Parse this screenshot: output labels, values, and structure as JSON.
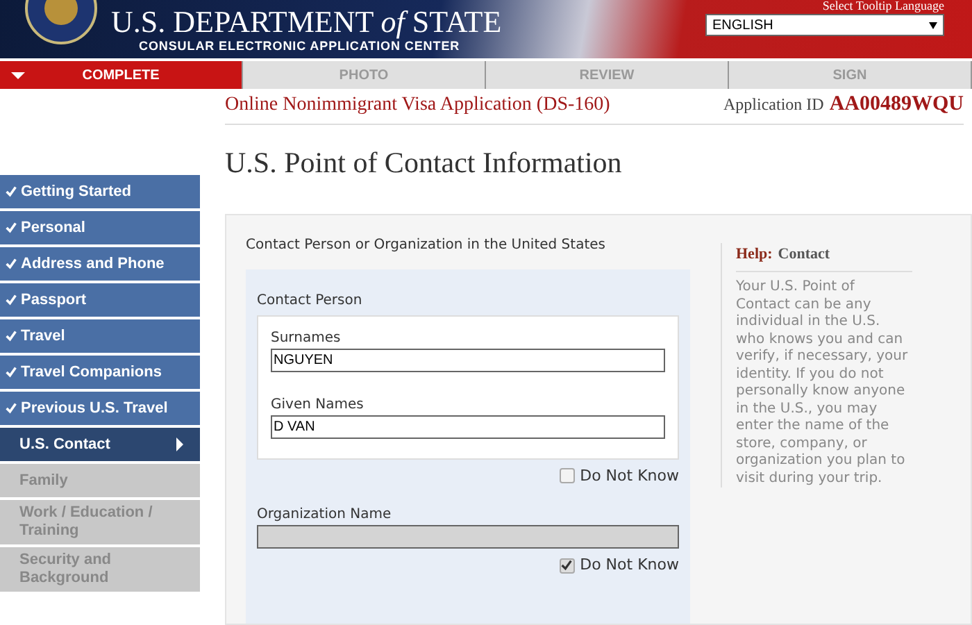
{
  "header": {
    "title": "U.S. DEPARTMENT *of* STATE",
    "subtitle": "CONSULAR ELECTRONIC APPLICATION CENTER",
    "language_label": "Select Tooltip Language",
    "language": "ENGLISH"
  },
  "steps": [
    {
      "label": "COMPLETE",
      "selected": true
    },
    {
      "label": "PHOTO",
      "selected": false
    },
    {
      "label": "REVIEW",
      "selected": false
    },
    {
      "label": "SIGN",
      "selected": false
    }
  ],
  "form_title": "Online Nonimmigrant Visa Application (DS-160)",
  "application_id_label": "Application ID",
  "application_id": "AA00489WQU",
  "sidebar": {
    "items": [
      {
        "label": "Getting Started",
        "kind": "done"
      },
      {
        "label": "Personal",
        "kind": "done"
      },
      {
        "label": "Address and Phone",
        "kind": "done"
      },
      {
        "label": "Passport",
        "kind": "done"
      },
      {
        "label": "Travel",
        "kind": "done"
      },
      {
        "label": "Travel Companions",
        "kind": "done"
      },
      {
        "label": "Previous U.S. Travel",
        "kind": "done"
      },
      {
        "label": "U.S. Contact",
        "kind": "current"
      },
      {
        "label": "Family",
        "kind": "locked"
      },
      {
        "label": "Work / Education / Training",
        "kind": "locked"
      },
      {
        "label": "Security and Background",
        "kind": "locked"
      }
    ]
  },
  "page_title": "U.S. Point of Contact Information",
  "section_title": "Contact Person or Organization in the United States",
  "contact_person": {
    "legend": "Contact Person",
    "fields": [
      {
        "label": "Surnames",
        "value": "NGUYEN"
      },
      {
        "label": "Given Names",
        "value": "D VAN"
      }
    ],
    "do_not_know": {
      "label": "Do Not Know",
      "checked": false
    }
  },
  "organization": {
    "label": "Organization Name",
    "disabled": true,
    "do_not_know": {
      "label": "Do Not Know",
      "checked": true
    }
  },
  "help": {
    "label": "Help:",
    "topic": "Contact",
    "text": "Your U.S. Point of Contact can be any individual in the U.S. who knows you and can verify, if necessary, your identity. If you do not personally know anyone in the U.S., you may enter the name of the store, company, or organization you plan to visit during your trip."
  }
}
